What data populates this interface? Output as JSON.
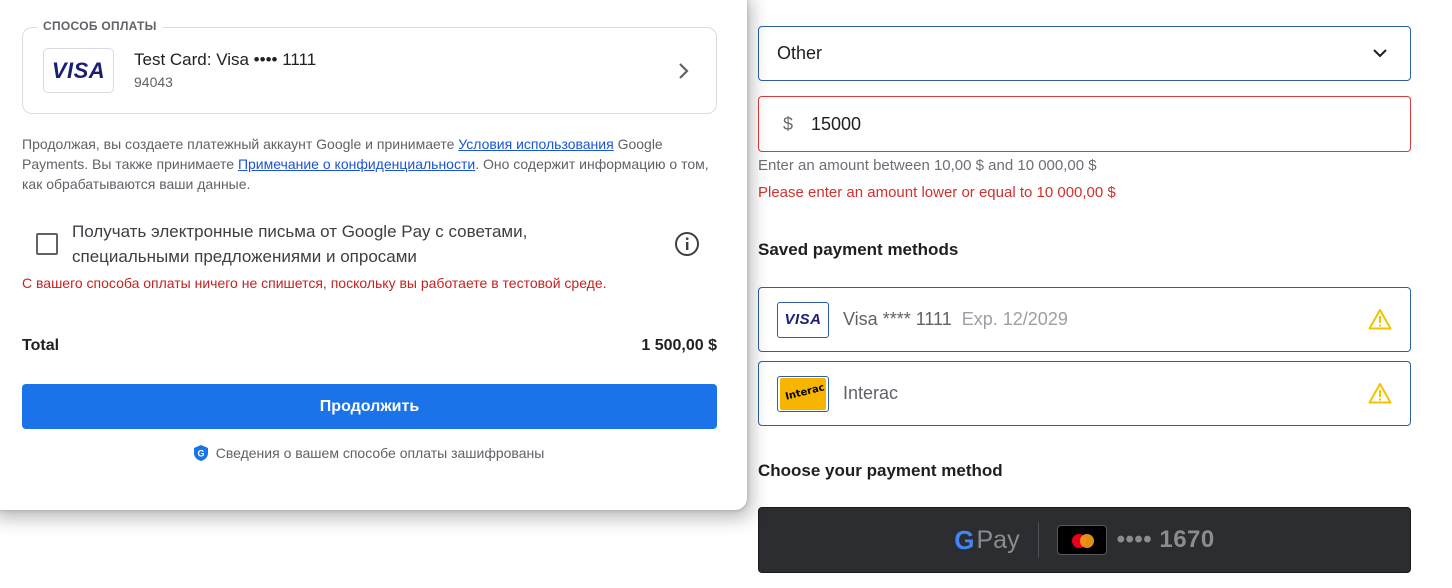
{
  "dialog": {
    "payment_method_legend": "СПОСОБ ОПЛАТЫ",
    "card_brand": "VISA",
    "card_title": "Test Card: Visa •••• 1111",
    "card_sub": "94043",
    "terms_part1": "Продолжая, вы создаете платежный аккаунт Google и принимаете ",
    "terms_link1": "Условия использования",
    "terms_part2": " Google Payments. Вы также принимаете ",
    "terms_link2": "Примечание о конфиденциальности",
    "terms_part3": ". Оно содержит информацию о том, как обрабатываются ваши данные.",
    "email_opt_in_label": "Получать электронные письма от Google Pay с советами, специальными предложениями и опросами",
    "email_opt_in_checked": false,
    "test_env_warning": "С вашего способа оплаты ничего не спишется, поскольку вы работаете в тестовой среде.",
    "total_label": "Total",
    "total_value": "1 500,00 $",
    "continue_label": "Продолжить",
    "secure_note": "Сведения о вашем способе оплаты зашифрованы"
  },
  "page": {
    "amount_select_value": "Other",
    "amount_currency": "$",
    "amount_value": "15000",
    "amount_hint": "Enter an amount between 10,00 $ and 10 000,00 $",
    "amount_error": "Please enter an amount lower or equal to 10 000,00 $",
    "saved_methods_heading": "Saved payment methods",
    "saved_methods": [
      {
        "brand": "VISA",
        "name": "Visa **** 1111",
        "expiry": "Exp. 12/2029",
        "warning_icon": "warning-icon"
      },
      {
        "brand": "Interac",
        "name": "Interac",
        "expiry": "",
        "warning_icon": "warning-icon"
      }
    ],
    "choose_method_heading": "Choose your payment method",
    "gpay_button": {
      "brand": "G",
      "pay": "Pay",
      "card_digits": "•••• 1670"
    }
  },
  "colors": {
    "primary_button": "#1a73e8",
    "error": "#d0312d",
    "link": "#1a55d6",
    "warning": "#f2c300",
    "gpay_bg": "#2b2d31"
  }
}
